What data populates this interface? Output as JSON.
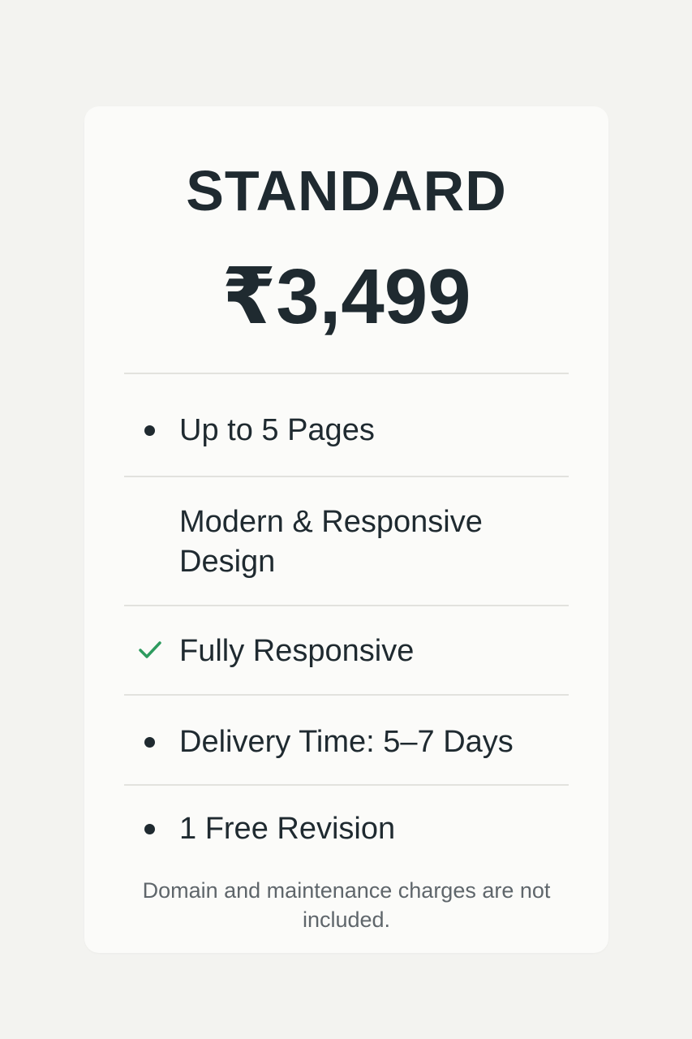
{
  "plan": {
    "name": "STANDARD",
    "price": "₹3,499"
  },
  "features": [
    {
      "label": "Up to 5 Pages",
      "icon": "bullet-icon"
    },
    {
      "label_line1": "Modern & Responsive",
      "label_line2": "Design",
      "icon": "none"
    },
    {
      "label": "Fully Responsive",
      "icon": "check-icon"
    },
    {
      "label": "Delivery Time: 5–7 Days",
      "icon": "bullet-icon"
    },
    {
      "label": "1 Free Revision",
      "icon": "bullet-icon"
    }
  ],
  "note": "Domain and maintenance charges are not included.",
  "colors": {
    "background": "#f3f3f0",
    "card": "#fbfbf9",
    "text": "#1f2a30",
    "check": "#2e9b5f",
    "divider": "#e2e2de",
    "note": "#5f666b"
  }
}
